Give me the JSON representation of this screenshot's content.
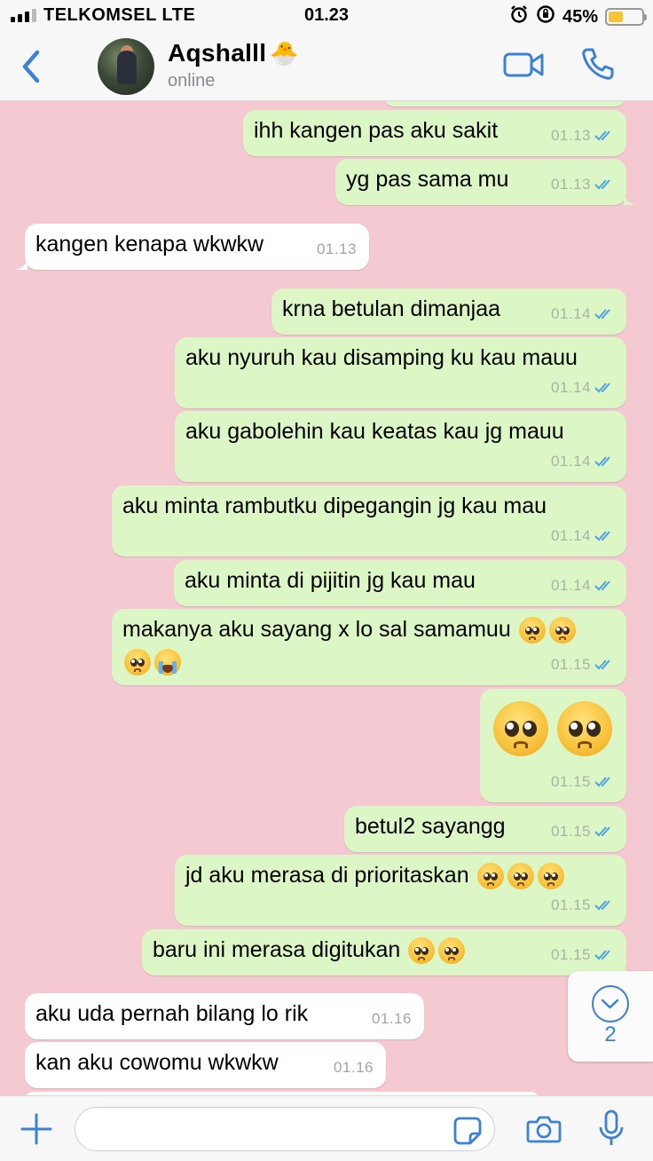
{
  "status_bar": {
    "carrier": "TELKOMSEL  LTE",
    "time": "01.23",
    "battery": "45%",
    "battery_level": 0.45,
    "icons": [
      "signal-icon",
      "alarm-icon",
      "orientation-lock-icon",
      "battery-icon"
    ]
  },
  "header": {
    "back_icon": "chevron-left-icon",
    "contact_name": "Aqshalll",
    "name_emoji": "🐣",
    "status": "online",
    "icons": [
      "video-call-icon",
      "phone-icon"
    ]
  },
  "colors": {
    "chat_background": "#f4c9d1",
    "outgoing_bubble": "#dcf7c5",
    "incoming_bubble": "#ffffff",
    "accent": "#3b82d6",
    "read_ticks": "#4fa3e0"
  },
  "messages": [
    {
      "dir": "out",
      "text": "ihh kangen pas aku sakit",
      "time": "01.13",
      "read": true
    },
    {
      "dir": "out",
      "text": "yg pas sama mu",
      "time": "01.13",
      "read": true
    },
    {
      "dir": "in",
      "text": "kangen kenapa wkwkw",
      "time": "01.13"
    },
    {
      "dir": "out",
      "text": "krna betulan dimanjaa",
      "time": "01.14",
      "read": true
    },
    {
      "dir": "out",
      "text": "aku nyuruh kau disamping ku kau mauu",
      "time": "01.14",
      "read": true
    },
    {
      "dir": "out",
      "text": "aku gabolehin kau keatas kau jg mauu",
      "time": "01.14",
      "read": true
    },
    {
      "dir": "out",
      "text": "aku minta rambutku dipegangin jg kau mau",
      "time": "01.14",
      "read": true
    },
    {
      "dir": "out",
      "text": "aku minta di pijitin jg kau mau",
      "time": "01.14",
      "read": true
    },
    {
      "dir": "out",
      "text": "makanya aku sayang x lo sal samamuu",
      "emoji_line1": "🥺🥺",
      "emoji_line2": "🥺😭",
      "time": "01.15",
      "read": true
    },
    {
      "dir": "out",
      "emoji_big": "🥺🥺",
      "time": "01.15",
      "read": true
    },
    {
      "dir": "out",
      "text": "betul2 sayangg",
      "time": "01.15",
      "read": true
    },
    {
      "dir": "out",
      "text": "jd aku merasa di prioritaskan",
      "emoji": "🥺🥺🥺",
      "time": "01.15",
      "read": true
    },
    {
      "dir": "out",
      "text": "baru ini merasa digitukan",
      "emoji": "🥺🥺",
      "time": "01.15",
      "read": true
    },
    {
      "dir": "in",
      "text": "aku uda pernah bilang lo rik",
      "time": "01.16"
    },
    {
      "dir": "in",
      "text": "kan aku cowomu wkwkw",
      "time": "01.16"
    }
  ],
  "scroll_down": {
    "icon": "chevron-down-icon",
    "unread_count": "2"
  },
  "input_bar": {
    "placeholder": "",
    "icons": [
      "plus-icon",
      "sticker-icon",
      "camera-icon",
      "microphone-icon"
    ]
  }
}
